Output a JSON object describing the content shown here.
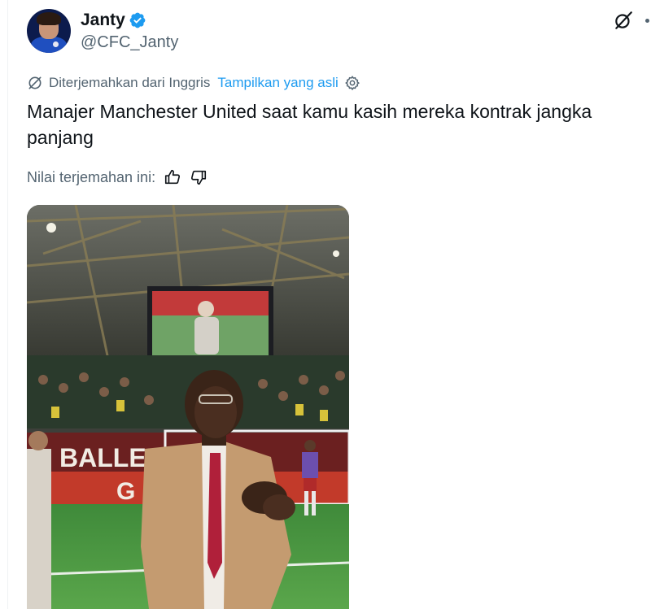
{
  "author": {
    "display_name": "Janty",
    "handle": "@CFC_Janty",
    "avatar_icon": "profile-avatar",
    "verified_icon": "verified-badge-icon",
    "verified_color": "#1d9bf0"
  },
  "actions": {
    "grok_icon": "grok-icon",
    "more_icon": "more-options-icon"
  },
  "translation": {
    "label": "Diterjemahkan dari Inggris",
    "show_original": "Tampilkan yang asli",
    "rate_label": "Nilai terjemahan ini:"
  },
  "tweet": {
    "text": "Manajer Manchester United saat kamu kasih mereka kontrak jangka panjang"
  },
  "media": {
    "banner_text": "BALLER GU",
    "banner_text_2": "G"
  },
  "colors": {
    "link": "#1d9bf0",
    "secondary_text": "#536471",
    "primary_text": "#0f1419"
  }
}
